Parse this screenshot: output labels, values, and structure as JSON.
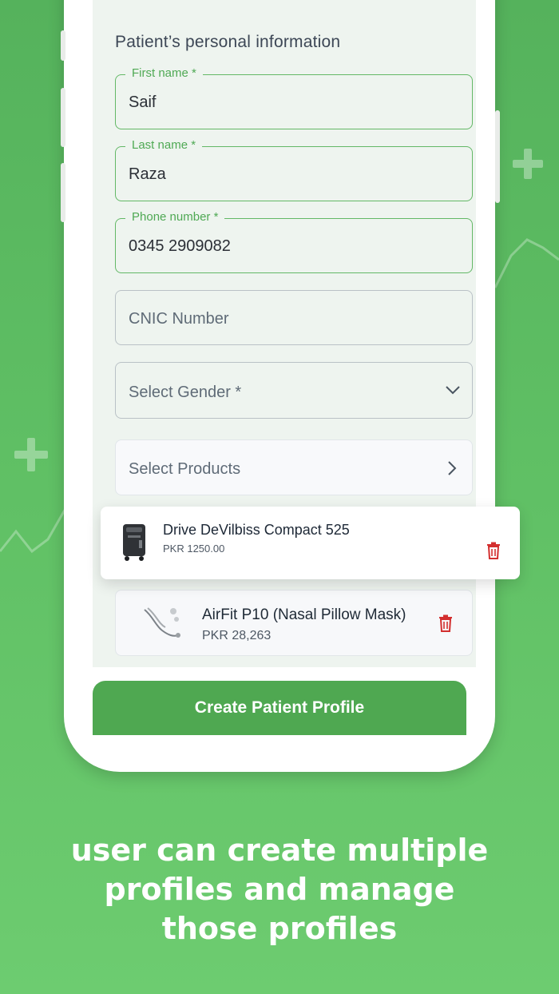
{
  "form": {
    "section_title": "Patient’s personal information",
    "first_name": {
      "label": "First name *",
      "value": "Saif"
    },
    "last_name": {
      "label": "Last name *",
      "value": "Raza"
    },
    "phone": {
      "label": "Phone number *",
      "value": "0345 2909082"
    },
    "cnic": {
      "placeholder": "CNIC Number"
    },
    "gender": {
      "placeholder": "Select Gender *"
    },
    "products": {
      "placeholder": "Select Products"
    }
  },
  "selected_products": [
    {
      "name": "Drive DeVilbiss Compact 525",
      "price": "PKR 1250.00"
    },
    {
      "name": "AirFit P10 (Nasal Pillow Mask)",
      "price": "PKR 28,263"
    }
  ],
  "create_button": "Create Patient Profile",
  "caption": [
    "user can create multiple",
    "profiles and manage",
    "those profiles"
  ],
  "colors": {
    "brand_green": "#4fa851",
    "delete_red": "#d32f2f",
    "background_green": "#5fbf64"
  },
  "icons": {
    "dropdown": "chevron-down-icon",
    "navigate": "chevron-right-icon",
    "delete": "trash-icon",
    "decor": "plus-icon"
  }
}
